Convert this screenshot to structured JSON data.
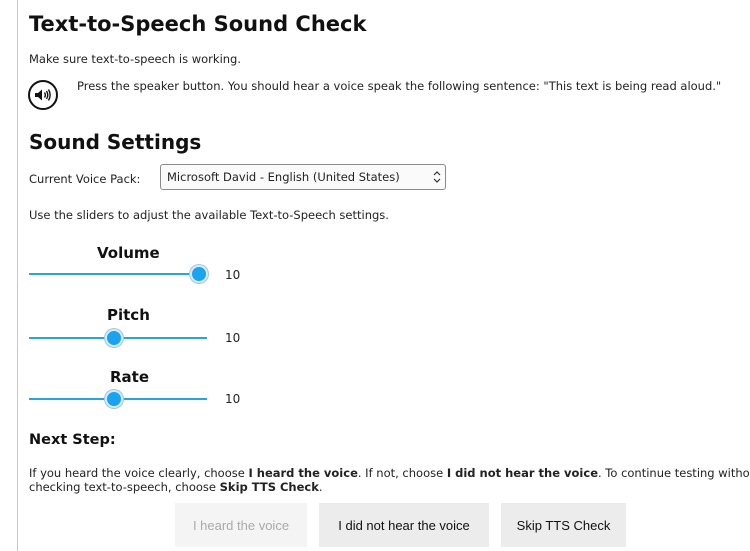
{
  "header": {
    "title": "Text-to-Speech Sound Check",
    "intro": "Make sure text-to-speech is working."
  },
  "speaker": {
    "icon": "speaker-icon",
    "instruction": "Press the speaker button. You should hear a voice speak the following sentence: \"This text is being read aloud.\""
  },
  "settings": {
    "title": "Sound Settings",
    "voice_label": "Current Voice Pack:",
    "voice_selected": "Microsoft David - English (United States)",
    "hint": "Use the sliders to adjust the available Text-to-Speech settings."
  },
  "sliders": [
    {
      "label": "Volume",
      "value": "10",
      "fraction": 1.0
    },
    {
      "label": "Pitch",
      "value": "10",
      "fraction": 0.5
    },
    {
      "label": "Rate",
      "value": "10",
      "fraction": 0.5
    }
  ],
  "next_step": {
    "title": "Next Step:",
    "t1": "If you heard the voice clearly, choose ",
    "b1": "I heard the voice",
    "t2": ". If not, choose ",
    "b2": "I did not hear the voice",
    "t3": ". To continue testing without checking text-to-speech, choose ",
    "b3": "Skip TTS Check",
    "t4": "."
  },
  "buttons": {
    "heard": "I heard the voice",
    "not_heard": "I did not hear the voice",
    "skip": "Skip TTS Check"
  },
  "colors": {
    "slider_accent": "#1aa3f0",
    "track": "#2aa6d6"
  }
}
